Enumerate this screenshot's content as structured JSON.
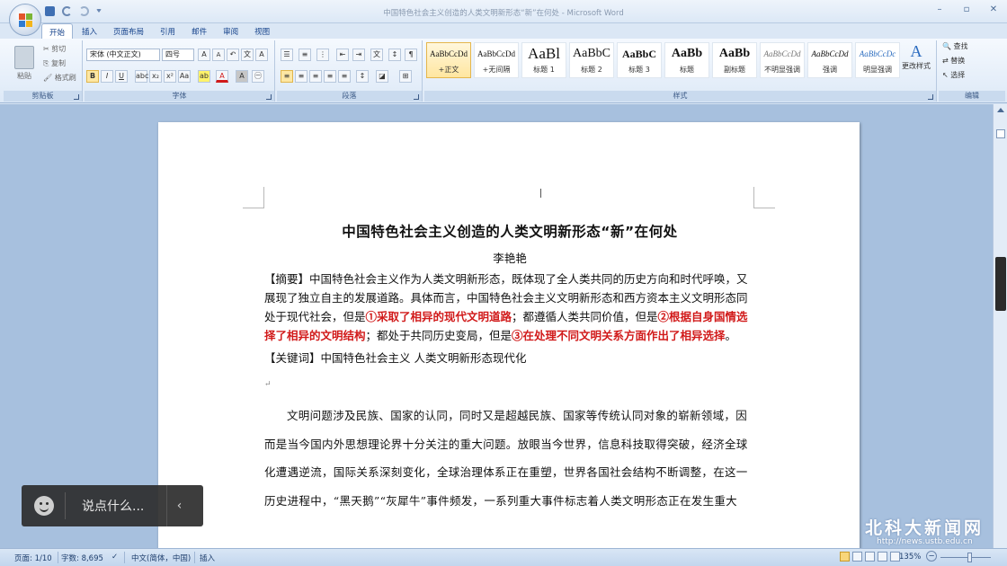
{
  "window": {
    "title": "中国特色社会主义创造的人类文明新形态“新”在何处 - Microsoft Word"
  },
  "tabs": [
    "开始",
    "插入",
    "页面布局",
    "引用",
    "邮件",
    "审阅",
    "视图"
  ],
  "clipboard": {
    "paste_label": "粘贴",
    "cut_label": "剪切",
    "copy_label": "复制",
    "format_painter_label": "格式刷",
    "group_label": "剪贴板"
  },
  "font": {
    "font_name": "宋体 (中文正文)",
    "font_size": "四号",
    "group_label": "字体",
    "bold": "B",
    "italic": "I",
    "underline": "U",
    "grow": "A",
    "shrink": "A",
    "font_color": "A",
    "highlight": "ab"
  },
  "paragraph": {
    "group_label": "段落"
  },
  "styles": {
    "group_label": "样式",
    "items": [
      {
        "sample": "AaBbCcDd",
        "name": "+正文"
      },
      {
        "sample": "AaBbCcDd",
        "name": "+无间隔"
      },
      {
        "sample": "AaBl",
        "name": "标题 1"
      },
      {
        "sample": "AaBbC",
        "name": "标题 2"
      },
      {
        "sample": "AaBbC",
        "name": "标题 3"
      },
      {
        "sample": "AaBb",
        "name": "标题"
      },
      {
        "sample": "AaBb",
        "name": "副标题"
      },
      {
        "sample": "AaBbCcDd",
        "name": "不明显强调"
      },
      {
        "sample": "AaBbCcDd",
        "name": "强调"
      },
      {
        "sample": "AaBbCcDc",
        "name": "明显强调"
      }
    ],
    "change_label": "更改样式"
  },
  "editing": {
    "find_label": "查找",
    "replace_label": "替换",
    "select_label": "选择",
    "group_label": "编辑"
  },
  "document": {
    "heading": "中国特色社会主义创造的人类文明新形态“新”在何处",
    "author": "李艳艳",
    "abstract_prefix": "【摘要】中国特色社会主义作为人类文明新形态，既体现了全人类共同的历史方向和时代呼唤，又展现了独立自主的发展道路。具体而言，中国特色社会主义文明新形态和西方资本主义文明形态同处于现代社会，但是",
    "abstract_red1": "①采取了相异的现代文明道路",
    "abstract_mid1": "；都遵循人类共同价值，但是",
    "abstract_red2": "②根据自身国情选择了相异的文明结构",
    "abstract_mid2": "；都处于共同历史变局，但是",
    "abstract_red3": "③在处理不同文明关系方面作出了相异选择",
    "abstract_end": "。",
    "keywords": "【关键词】中国特色社会主义 人类文明新形态现代化",
    "body": "文明问题涉及民族、国家的认同，同时又是超越民族、国家等传统认同对象的崭新领域，因而是当今国内外思想理论界十分关注的重大问题。放眼当今世界，信息科技取得突破，经济全球化遭遇逆流，国际关系深刻变化，全球治理体系正在重塑，世界各国社会结构不断调整，在这一历史进程中，“黑天鹅”“灰犀牛”事件频发，一系列重大事件标志着人类文明形态正在发生重大"
  },
  "comment": {
    "placeholder": "说点什么..."
  },
  "watermark": {
    "name": "北科大新闻网",
    "url": "http://news.ustb.edu.cn"
  },
  "statusbar": {
    "page": "页面: 1/10",
    "words": "字数: 8,695",
    "language": "中文(简体，中国)",
    "mode": "插入",
    "zoom": "135%"
  },
  "colors": {
    "accent_red": "#d11a1a",
    "ribbon_blue": "#15428b"
  }
}
